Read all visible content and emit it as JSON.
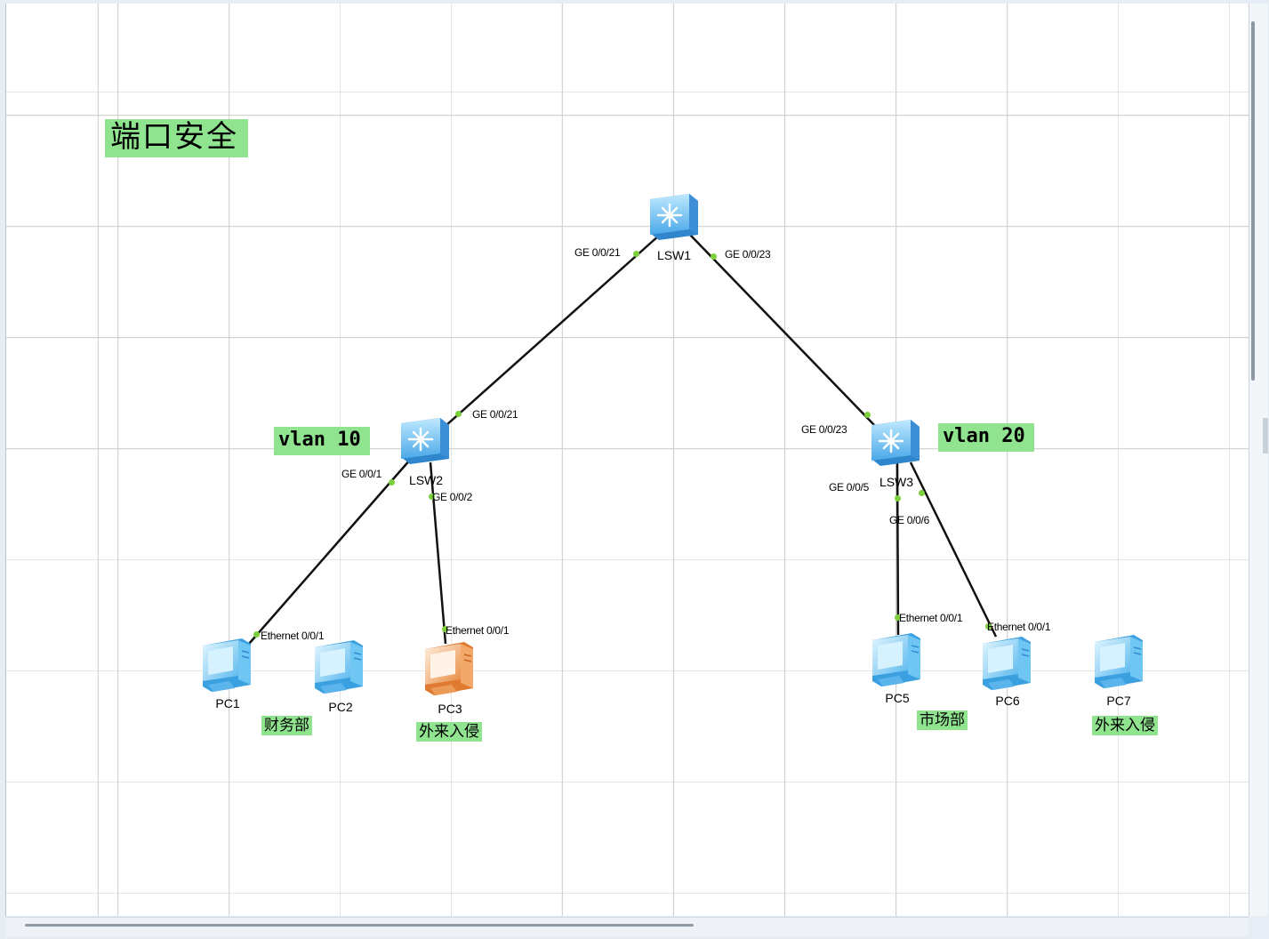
{
  "canvas": {
    "title": "端口安全",
    "vlan_left": "vlan 10",
    "vlan_right": "vlan 20",
    "dept_finance": "财务部",
    "dept_market": "市场部",
    "intruder_left": "外来入侵",
    "intruder_right": "外来入侵"
  },
  "devices": {
    "lsw1": "LSW1",
    "lsw2": "LSW2",
    "lsw3": "LSW3",
    "pc1": "PC1",
    "pc2": "PC2",
    "pc3": "PC3",
    "pc5": "PC5",
    "pc6": "PC6",
    "pc7": "PC7"
  },
  "ports": {
    "lsw1_ge21": "GE 0/0/21",
    "lsw1_ge23": "GE 0/0/23",
    "lsw2_ge21": "GE 0/0/21",
    "lsw2_ge1": "GE 0/0/1",
    "lsw2_ge2": "GE 0/0/2",
    "lsw3_ge23": "GE 0/0/23",
    "lsw3_ge5": "GE 0/0/5",
    "lsw3_ge6": "GE 0/0/6",
    "pc1_eth": "Ethernet 0/0/1",
    "pc3_eth": "Ethernet 0/0/1",
    "pc5_eth": "Ethernet 0/0/1",
    "pc6_eth": "Ethernet 0/0/1"
  },
  "colors": {
    "label_bg": "#90e490",
    "port_dot": "#7cd03c",
    "switch": "#5bb8f0",
    "pc": "#6cc8f4",
    "pc_intruder": "#f0a060"
  },
  "icons": {
    "switch": "switch-icon",
    "pc": "pc-icon",
    "pc_intruder": "pc-intruder-icon"
  }
}
